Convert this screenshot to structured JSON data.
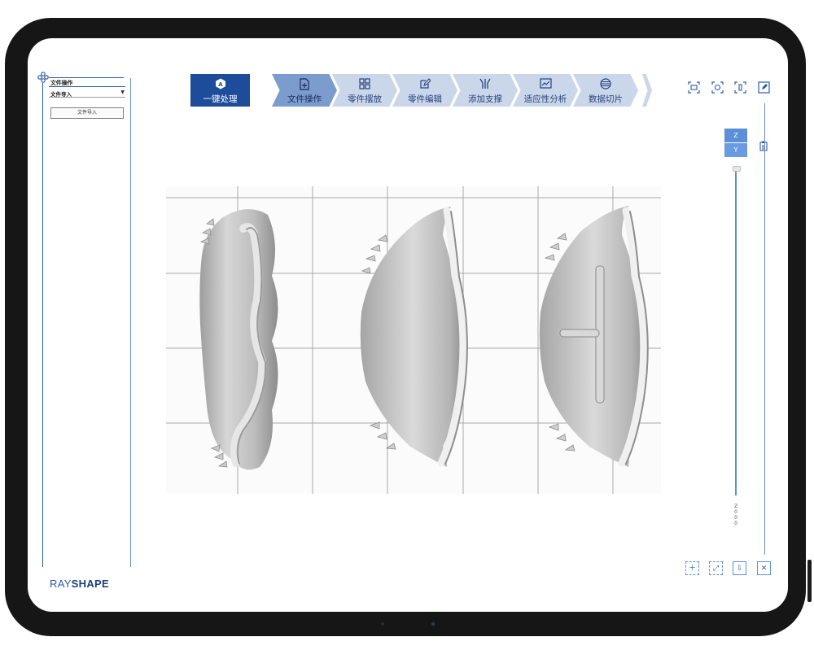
{
  "left_panel": {
    "section_title": "文件操作",
    "dropdown_value": "文件导入",
    "import_button": "文件导入",
    "brand_part1": "RAY",
    "brand_part2": "SHAPE"
  },
  "workflow": {
    "steps": [
      {
        "label": "一键处理",
        "icon": "auto-icon",
        "state": "primary"
      },
      {
        "label": "文件操作",
        "icon": "file-add-icon",
        "state": "active"
      },
      {
        "label": "零件摆放",
        "icon": "grid-icon",
        "state": "normal"
      },
      {
        "label": "零件编辑",
        "icon": "edit-icon",
        "state": "normal"
      },
      {
        "label": "添加支撑",
        "icon": "support-icon",
        "state": "normal"
      },
      {
        "label": "适应性分析",
        "icon": "analysis-icon",
        "state": "normal"
      },
      {
        "label": "数据切片",
        "icon": "slice-icon",
        "state": "normal"
      }
    ]
  },
  "view_controls": {
    "axis_z": "Z",
    "axis_y": "Y",
    "slider_label": "Z\n0\n0\n0"
  },
  "colors": {
    "primary": "#1d4c9b",
    "active_step": "#7c9ccd",
    "step": "#cad6ea",
    "accent": "#5b8fd8"
  }
}
